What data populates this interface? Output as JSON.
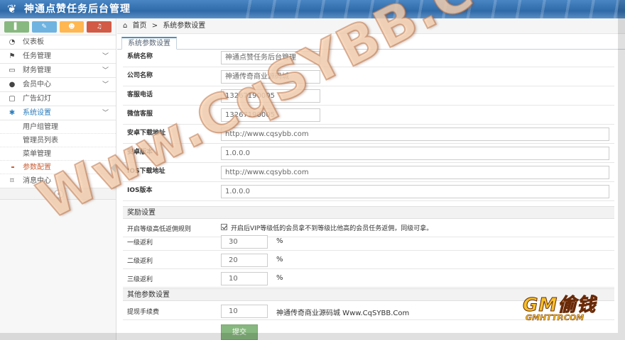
{
  "header": {
    "title": "神通点赞任务后台管理",
    "icon": "feather-icon"
  },
  "shortcuts": [
    {
      "icon": "signal-icon",
      "glyph": "▌",
      "color": "#87b87f"
    },
    {
      "icon": "pencil-icon",
      "glyph": "✎",
      "color": "#6fb3e0"
    },
    {
      "icon": "users-icon",
      "glyph": "☻",
      "color": "#ffb752"
    },
    {
      "icon": "bell-icon",
      "glyph": "♫",
      "color": "#d15b47"
    }
  ],
  "nav": [
    {
      "label": "仪表板",
      "icon": "dashboard-icon",
      "glyph": "◔",
      "chevron": false
    },
    {
      "label": "任务管理",
      "icon": "flag-icon",
      "glyph": "⚑",
      "chevron": true
    },
    {
      "label": "财务管理",
      "icon": "inbox-icon",
      "glyph": "▭",
      "chevron": true
    },
    {
      "label": "会员中心",
      "icon": "user-icon",
      "glyph": "●",
      "chevron": true
    },
    {
      "label": "广告幻灯",
      "icon": "picture-icon",
      "glyph": "▢",
      "chevron": false
    },
    {
      "label": "系统设置",
      "icon": "cogs-icon",
      "glyph": "✱",
      "chevron": true,
      "active": true
    }
  ],
  "subnav": [
    {
      "label": "用户组管理"
    },
    {
      "label": "管理员列表"
    },
    {
      "label": "菜单管理"
    },
    {
      "label": "参数配置",
      "current": true
    }
  ],
  "nav_after": {
    "label": "消息中心",
    "icon": "bookmark-icon",
    "glyph": "⌑"
  },
  "collapse_glyph": "«",
  "breadcrumb": {
    "home": "首页",
    "sep": ">",
    "current": "系统参数设置",
    "home_glyph": "⌂"
  },
  "tab": {
    "label": "系统参数设置"
  },
  "fields": [
    {
      "label": "系统名称",
      "value": "神通点赞任务后台管理",
      "width": "short"
    },
    {
      "label": "公司名称",
      "value": "神通传奇商业源码城",
      "width": "short"
    },
    {
      "label": "客服电话",
      "value": "13267190005",
      "width": "short"
    },
    {
      "label": "微信客服",
      "value": "13267190005",
      "width": "short"
    },
    {
      "label": "安卓下载地址",
      "value": "http://www.cqsybb.com",
      "width": "long"
    },
    {
      "label": "安卓版本",
      "value": "1.0.0.0",
      "width": "long"
    },
    {
      "label": "IOS下载地址",
      "value": "http://www.cqsybb.com",
      "width": "long"
    },
    {
      "label": "IOS版本",
      "value": "1.0.0.0",
      "width": "long"
    }
  ],
  "reward": {
    "title": "奖励设置",
    "rule_label": "开启等级高低返佣规则",
    "rule_desc": "开启后VIP等级低的会员拿不到等级比他高的会员任务返佣，同级可拿。",
    "levels": [
      {
        "label": "一级返利",
        "value": "30",
        "unit": "%"
      },
      {
        "label": "二级返利",
        "value": "20",
        "unit": "%"
      },
      {
        "label": "三级返利",
        "value": "10",
        "unit": "%"
      }
    ]
  },
  "other": {
    "title": "其他参数设置",
    "fee_label": "提现手续费",
    "fee_value": "10",
    "fee_note": "神通传奇商业源码城 Www.CqSYBB.Com"
  },
  "submit_label": "提交",
  "watermark": {
    "text": "Www.CqSYBB.Com",
    "badge_main": "GM偷钱",
    "badge_site": "GMHTTP.COM"
  },
  "colors": {
    "header": "#2f6aa8",
    "active": "#2b7dbc",
    "submit": "#87b87f",
    "current_sub": "#c86139"
  }
}
